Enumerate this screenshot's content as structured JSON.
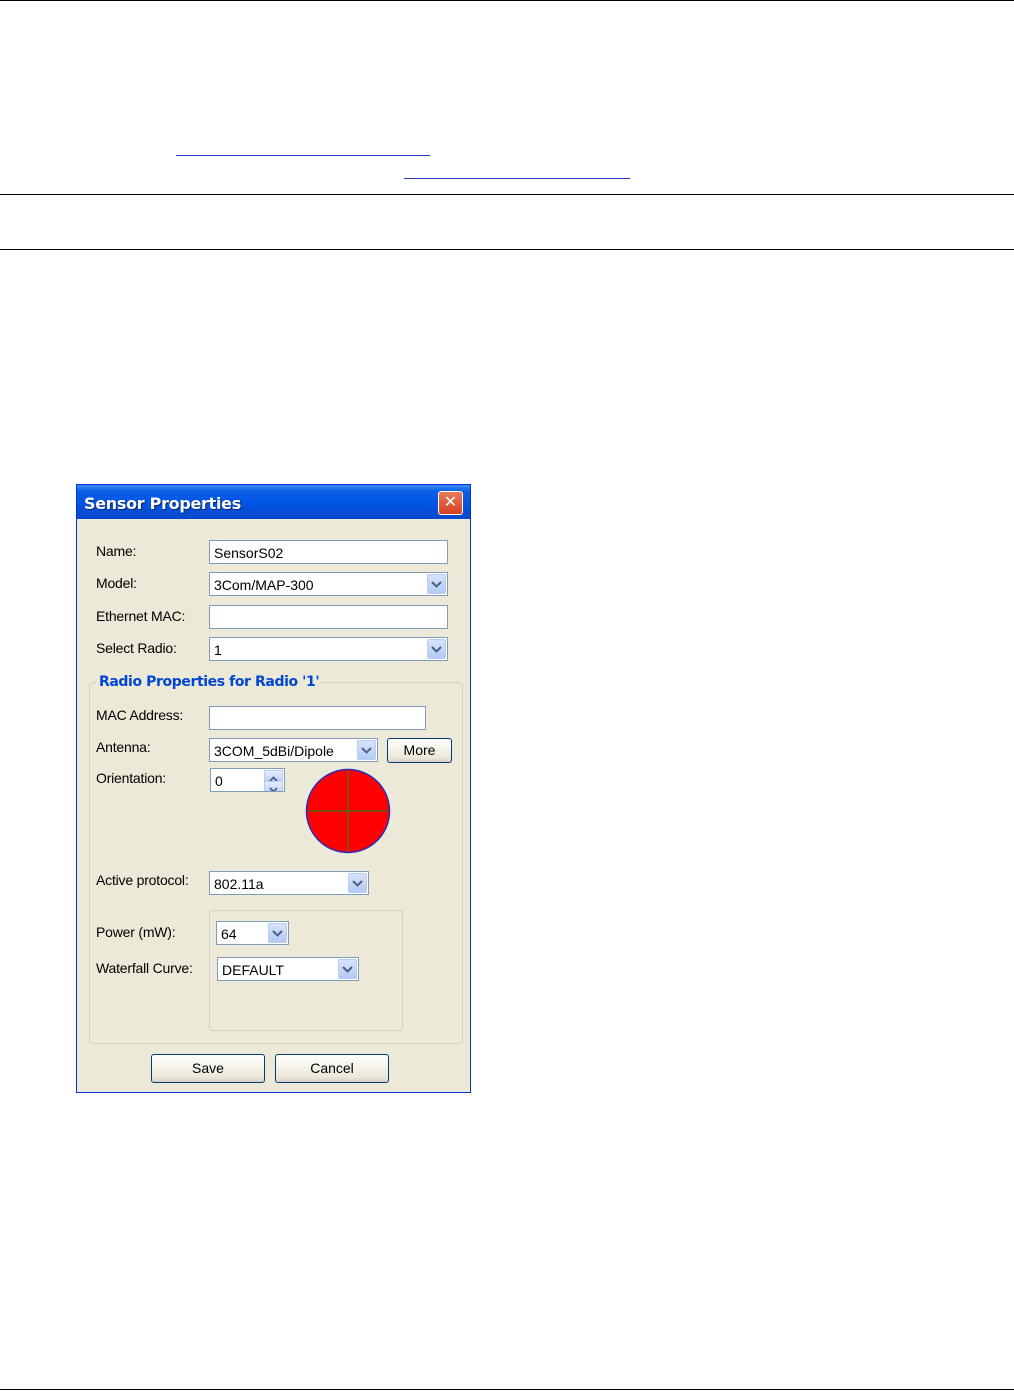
{
  "dialog": {
    "title": "Sensor Properties",
    "close_glyph": "✕",
    "fields": {
      "name": {
        "label": "Name:",
        "value": "SensorS02"
      },
      "model": {
        "label": "Model:",
        "value": "3Com/MAP-300"
      },
      "ethernet_mac": {
        "label": "Ethernet MAC:",
        "value": ""
      },
      "select_radio": {
        "label": "Select Radio:",
        "value": "1"
      }
    },
    "radio_group": {
      "title": "Radio Properties for Radio '1'",
      "mac_address": {
        "label": "MAC Address:",
        "value": ""
      },
      "antenna": {
        "label": "Antenna:",
        "value": "3COM_5dBi/Dipole",
        "more_label": "More"
      },
      "orientation": {
        "label": "Orientation:",
        "value": "0"
      },
      "active_protocol": {
        "label": "Active protocol:",
        "value": "802.11a"
      },
      "power": {
        "label": "Power (mW):",
        "value": "64"
      },
      "waterfall_curve": {
        "label": "Waterfall Curve:",
        "value": "DEFAULT"
      }
    },
    "buttons": {
      "save": "Save",
      "cancel": "Cancel"
    }
  },
  "icons": {
    "dropdown": "chevron-down-icon",
    "spinner_up": "caret-up-icon",
    "spinner_down": "caret-down-icon",
    "orientation": "orientation-indicator-icon"
  },
  "colors": {
    "titlebar": "#0054e3",
    "group_title": "#0046d5",
    "orientation_fill": "#ff0000",
    "link": "#2a36c8"
  }
}
